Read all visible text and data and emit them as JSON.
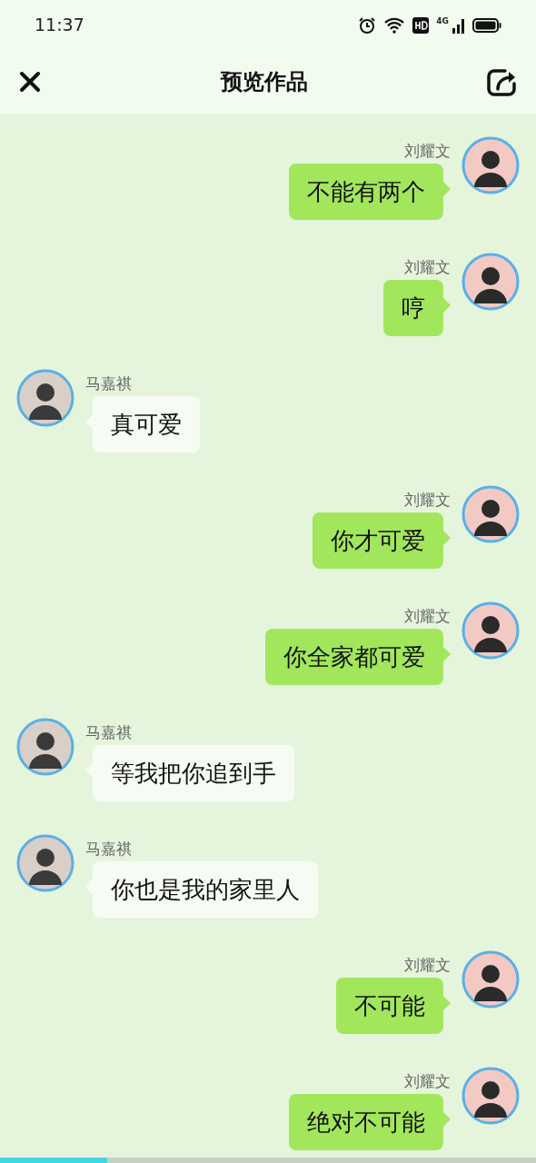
{
  "status_bar": {
    "time": "11:37",
    "network": "4G"
  },
  "header": {
    "title": "预览作品"
  },
  "messages": [
    {
      "kind": "right",
      "sender": "刘耀文",
      "text": "不能有两个"
    },
    {
      "kind": "right",
      "sender": "刘耀文",
      "text": "哼"
    },
    {
      "kind": "left",
      "sender": "马嘉祺",
      "text": "真可爱"
    },
    {
      "kind": "right",
      "sender": "刘耀文",
      "text": "你才可爱"
    },
    {
      "kind": "right",
      "sender": "刘耀文",
      "text": "你全家都可爱"
    },
    {
      "kind": "left",
      "sender": "马嘉祺",
      "text": "等我把你追到手"
    },
    {
      "kind": "left",
      "sender": "马嘉祺",
      "text": "你也是我的家里人"
    },
    {
      "kind": "right",
      "sender": "刘耀文",
      "text": "不可能"
    },
    {
      "kind": "right",
      "sender": "刘耀文",
      "text": "绝对不可能"
    }
  ],
  "progress": {
    "level": 0.2
  }
}
